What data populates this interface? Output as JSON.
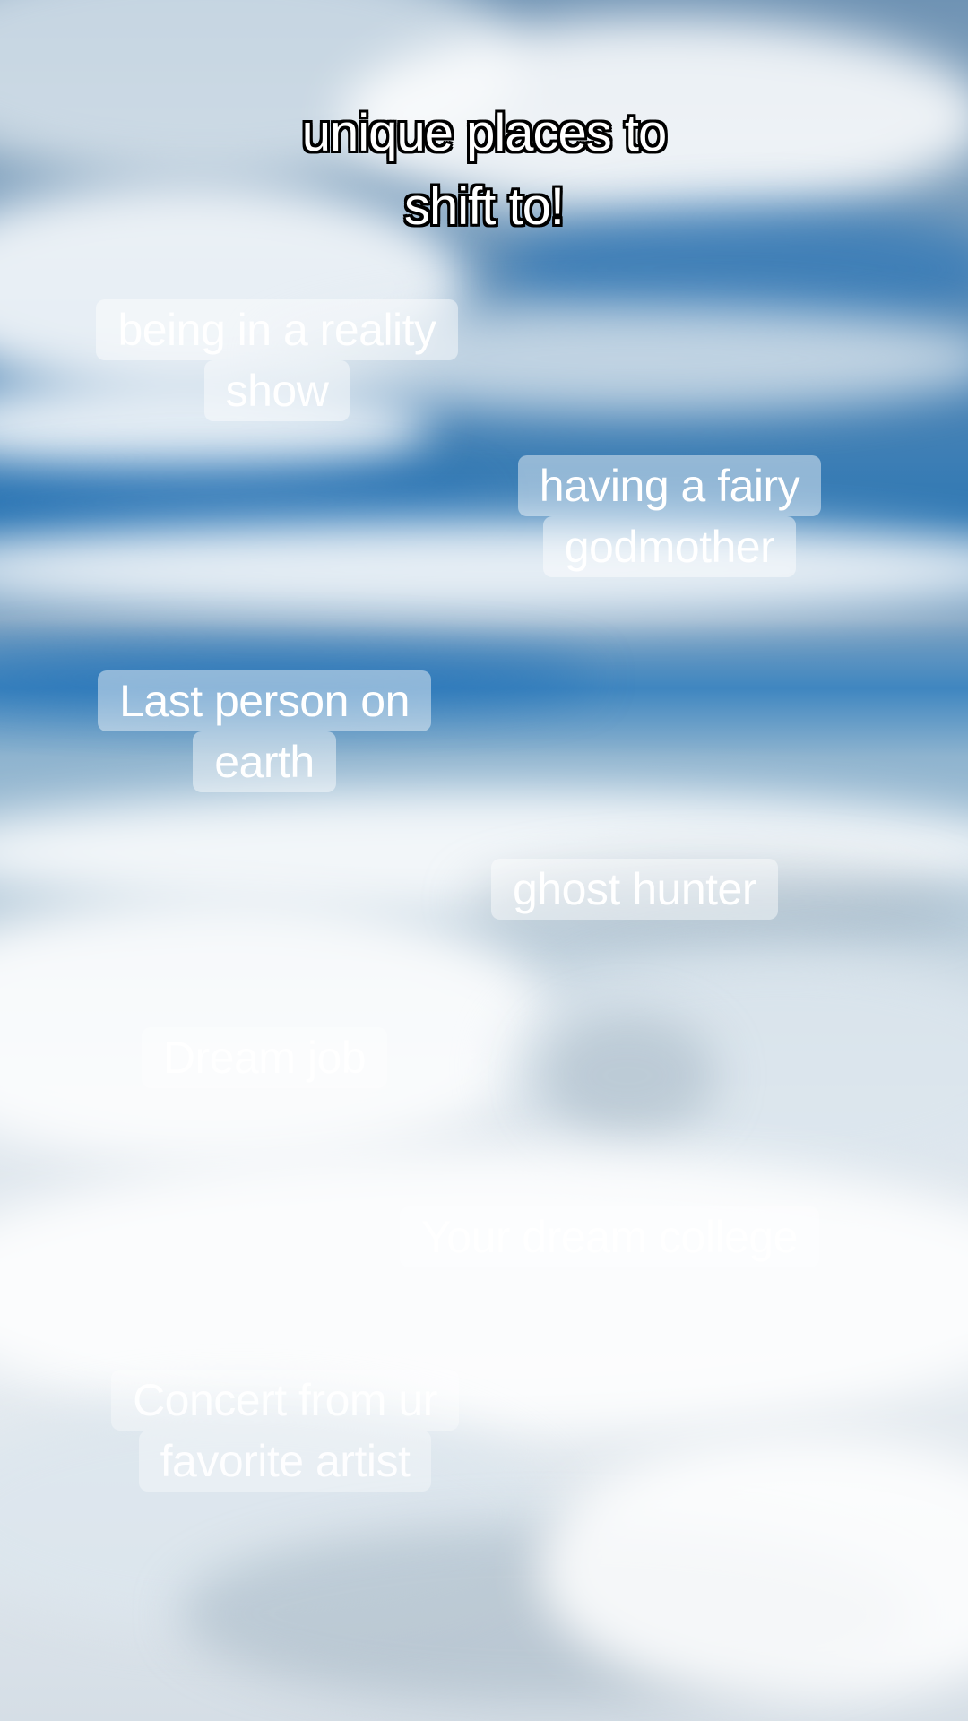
{
  "caption": {
    "lines": [
      "unique places to",
      "shift to!"
    ]
  },
  "items": [
    {
      "lines": [
        "being in a reality",
        "show"
      ]
    },
    {
      "lines": [
        "having a fairy",
        "godmother"
      ]
    },
    {
      "lines": [
        "Last person on",
        "earth"
      ]
    },
    {
      "lines": [
        "ghost hunter"
      ]
    },
    {
      "lines": [
        "Dream job"
      ]
    },
    {
      "lines": [
        "Your dream college"
      ]
    },
    {
      "lines": [
        "Concert from ur",
        "favorite artist"
      ]
    }
  ],
  "colors": {
    "sky_blue": "#2f78b4",
    "cloud_white": "#e6ecf1",
    "text": "#ffffff",
    "caption_outline": "#000000"
  }
}
